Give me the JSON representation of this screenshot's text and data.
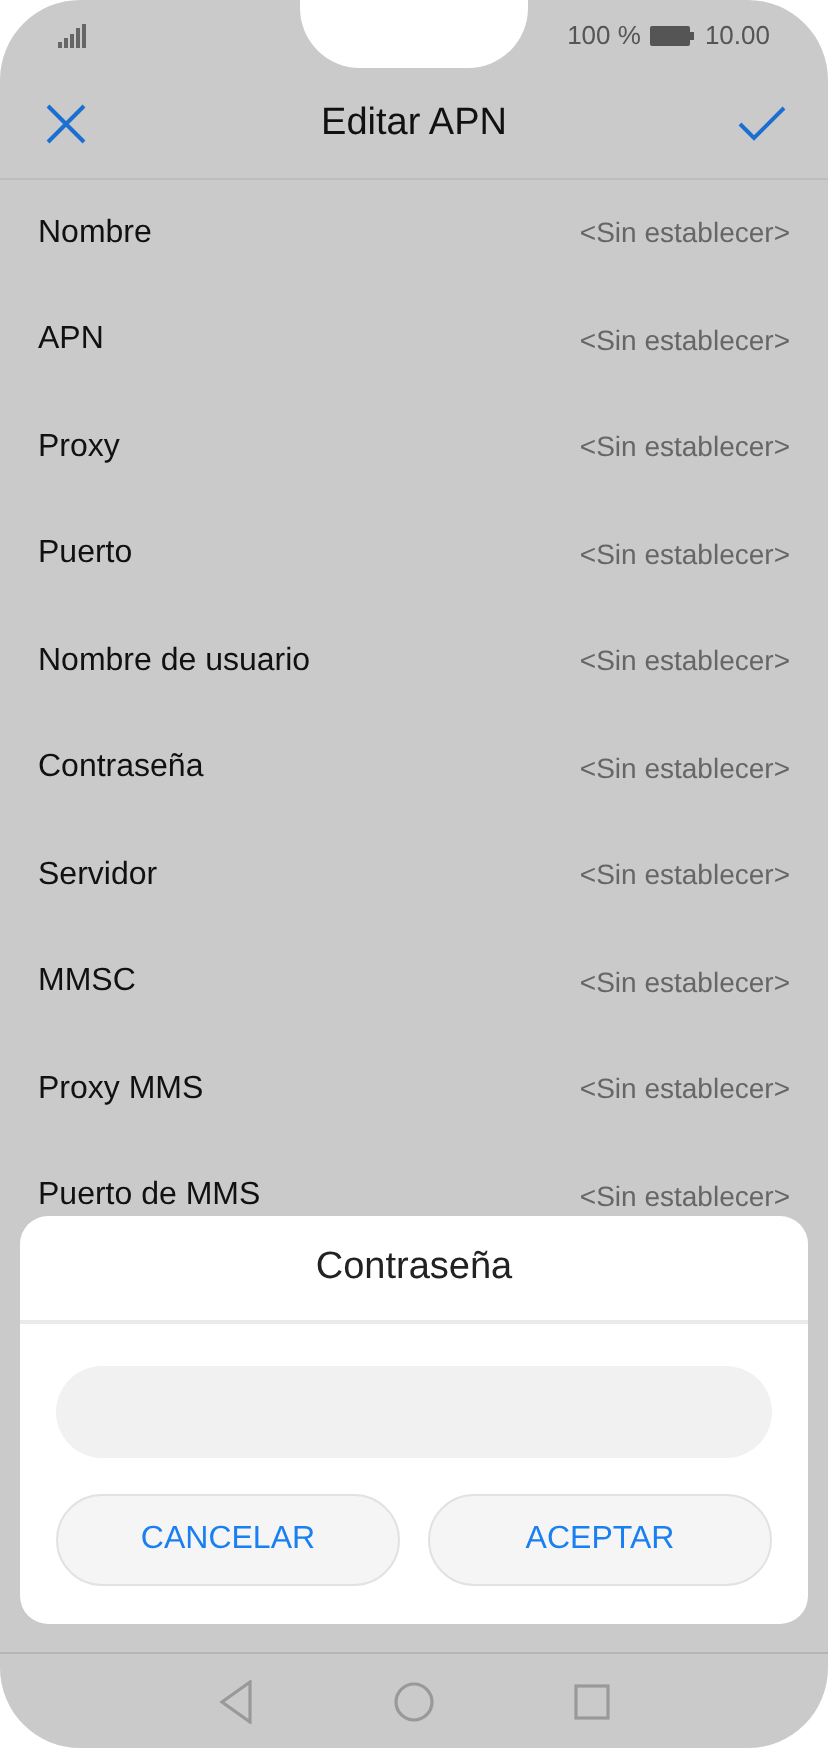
{
  "status_bar": {
    "battery": "100 %",
    "time": "10.00"
  },
  "header": {
    "title": "Editar APN"
  },
  "rows": [
    {
      "label": "Nombre",
      "value": "<Sin establecer>"
    },
    {
      "label": "APN",
      "value": "<Sin establecer>"
    },
    {
      "label": "Proxy",
      "value": "<Sin establecer>"
    },
    {
      "label": "Puerto",
      "value": "<Sin establecer>"
    },
    {
      "label": "Nombre de usuario",
      "value": "<Sin establecer>"
    },
    {
      "label": "Contraseña",
      "value": "<Sin establecer>"
    },
    {
      "label": "Servidor",
      "value": "<Sin establecer>"
    },
    {
      "label": "MMSC",
      "value": "<Sin establecer>"
    },
    {
      "label": "Proxy MMS",
      "value": "<Sin establecer>"
    },
    {
      "label": "Puerto de MMS",
      "value": "<Sin establecer>"
    }
  ],
  "dialog": {
    "title": "Contraseña",
    "buttons": [
      "CANCELAR",
      "ACEPTAR"
    ]
  }
}
